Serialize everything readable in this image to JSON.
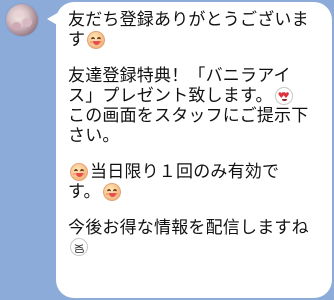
{
  "chat": {
    "avatar_icon": "sender-avatar-flower",
    "message": {
      "line1": "友だち登録ありがとうございま",
      "line2a": "す",
      "line3": "友達登録特典！「バニラアイ",
      "line4": "ス」プレゼント致します。",
      "line5": "この画面をスタッフにご提示下",
      "line6": "さい。",
      "line7": "当日限り１回のみ有効で",
      "line8a": "す。",
      "line9": "今後お得な情報を配信しますね"
    },
    "emojis": {
      "smile": "smiling-face-emoji",
      "heart_eyes": "heart-eyes-emoji",
      "grin": "grinning-teeth-emoji"
    },
    "colors": {
      "background": "#8cabd9",
      "bubble": "#ffffff",
      "text": "#111111"
    }
  }
}
